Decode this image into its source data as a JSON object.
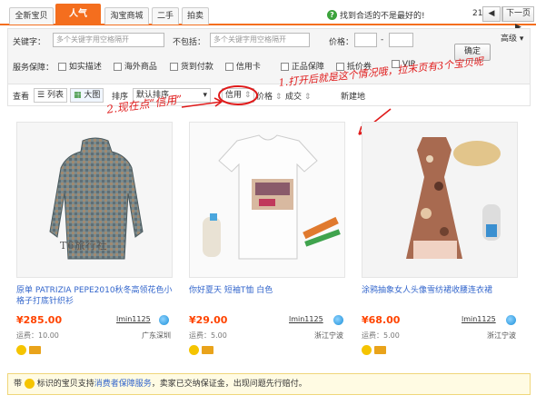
{
  "tabs": [
    "全新宝贝",
    "人气",
    "淘宝商城",
    "二手",
    "拍卖"
  ],
  "active_tab": "人气",
  "find_tip": "找到合适的不是最好的!",
  "pager": {
    "current": "21/21",
    "prev": "◀",
    "next": "下一页 ▶"
  },
  "filters": {
    "keyword_label": "关键字：",
    "keyword_placeholder": "多个关键字用空格隔开",
    "exclude_label": "不包括：",
    "exclude_placeholder": "多个关键字用空格隔开",
    "price_label": "价格：",
    "price_dash": "-",
    "advanced": "高级",
    "confirm": "确定",
    "service_label": "服务保障：",
    "checkboxes": [
      "如实描述",
      "海外商品",
      "货到付款",
      "信用卡",
      "正品保障",
      "抵价券",
      "VIP"
    ]
  },
  "sortbar": {
    "view_label": "查看",
    "list": "列表",
    "grid": "大图",
    "sort_label": "排序",
    "sort_select": "默认排序",
    "credit": "信用",
    "price": "价格",
    "sales": "成交",
    "new": "新建地"
  },
  "annotations": {
    "a1": "1.打开后就是这个情况哦，拉末页有3个宝贝呢",
    "a2": "2.现在点“信用”"
  },
  "products": [
    {
      "title": "原单 PATRIZIA PEPE2010秋冬高领花色小格子打底针织衫",
      "price": "¥285.00",
      "seller": "lmin1125",
      "shipping": "运费：10.00",
      "location": "广东深圳",
      "watermark": "T6旅行社"
    },
    {
      "title": "你好夏天 短袖T恤 白色",
      "price": "¥29.00",
      "seller": "lmin1125",
      "shipping": "运费：5.00",
      "location": "浙江宁波",
      "watermark": ""
    },
    {
      "title": "涂鸦抽象女人头像雪纺裙收腰连衣裙",
      "price": "¥68.00",
      "seller": "lmin1125",
      "shipping": "运费：5.00",
      "location": "浙江宁波",
      "watermark": ""
    }
  ],
  "bottom": {
    "pre": "带",
    "mid": "标识的宝贝支持",
    "link": "消费者保障服务",
    "post": "，卖家已交纳保证金，出现问题先行赔付。"
  },
  "colors": {
    "accent": "#f46e1e",
    "price": "#ff4400",
    "link": "#3366cc",
    "annotation": "#e01a1a"
  }
}
